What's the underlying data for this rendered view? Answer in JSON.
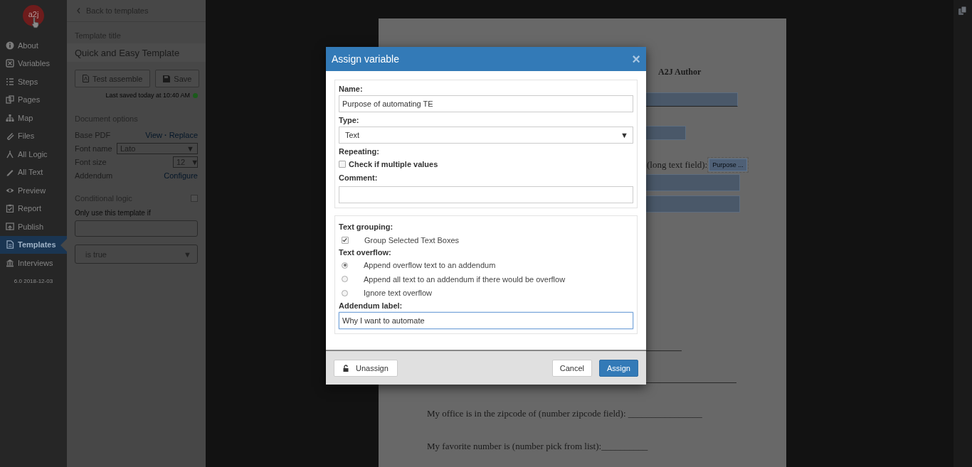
{
  "sidebar": {
    "logo": "a2j",
    "items": [
      {
        "label": "About",
        "selected": false
      },
      {
        "label": "Variables",
        "selected": false
      },
      {
        "label": "Steps",
        "selected": false
      },
      {
        "label": "Pages",
        "selected": false
      },
      {
        "label": "Map",
        "selected": false
      },
      {
        "label": "Files",
        "selected": false
      },
      {
        "label": "All Logic",
        "selected": false
      },
      {
        "label": "All Text",
        "selected": false
      },
      {
        "label": "Preview",
        "selected": false
      },
      {
        "label": "Report",
        "selected": false
      },
      {
        "label": "Publish",
        "selected": false
      },
      {
        "label": "Templates",
        "selected": true
      },
      {
        "label": "Interviews",
        "selected": false
      }
    ],
    "version": "6.0 2018-12-03"
  },
  "panel": {
    "back": "Back to templates",
    "title_label": "Template title",
    "title": "Quick and Easy Template",
    "buttons": [
      {
        "label": "Test assemble",
        "kind": "pdf"
      },
      {
        "label": "Save",
        "kind": "save"
      }
    ],
    "last_saved": "Last saved today at 10:40 AM",
    "options_heading": "Document options",
    "options": [
      {
        "label": "Base PDF",
        "kind": "links",
        "links": [
          "View",
          "Replace"
        ],
        "separator": "·"
      },
      {
        "label": "Font name",
        "kind": "select",
        "value": "Lato",
        "caret": "▼"
      },
      {
        "label": "Font size",
        "kind": "select",
        "value": "12",
        "caret": "▼"
      },
      {
        "label": "Addendum",
        "kind": "links",
        "links": [
          "Configure"
        ]
      }
    ],
    "conditional": {
      "label": "Conditional logic",
      "checked": false,
      "hint": "Only use this template if",
      "operator": "is true",
      "caret": "▼"
    }
  },
  "document": {
    "heading": "A2J Author",
    "long_text_label": "(long text field):",
    "chip": "Purpose ...",
    "lines": [
      "My office is in the zipcode of (number zipcode field): ________________",
      "My favorite number is (number pick from list):__________"
    ]
  },
  "dialog": {
    "title": "Assign variable",
    "close": "×",
    "name_label": "Name:",
    "name_value": "Purpose of automating TE",
    "type_label": "Type:",
    "type_value": "Text",
    "type_caret": "▼",
    "repeating_label": "Repeating:",
    "repeating": {
      "label": "Check if multiple values",
      "checked": false
    },
    "comment_label": "Comment:",
    "grouping_label": "Text grouping:",
    "grouping": {
      "label": "Group Selected Text Boxes",
      "checked": true
    },
    "overflow_label": "Text overflow:",
    "overflow_options": [
      {
        "label": "Append overflow text to an addendum",
        "selected": true
      },
      {
        "label": "Append all text to an addendum if there would be overflow",
        "selected": false
      },
      {
        "label": "Ignore text overflow",
        "selected": false
      }
    ],
    "addendum_label": "Addendum label:",
    "addendum_value": "Why I want to automate",
    "buttons": [
      {
        "label": "Unassign",
        "kind": "lock"
      },
      {
        "label": "Cancel",
        "kind": "default"
      },
      {
        "label": "Assign",
        "kind": "primary"
      }
    ]
  }
}
